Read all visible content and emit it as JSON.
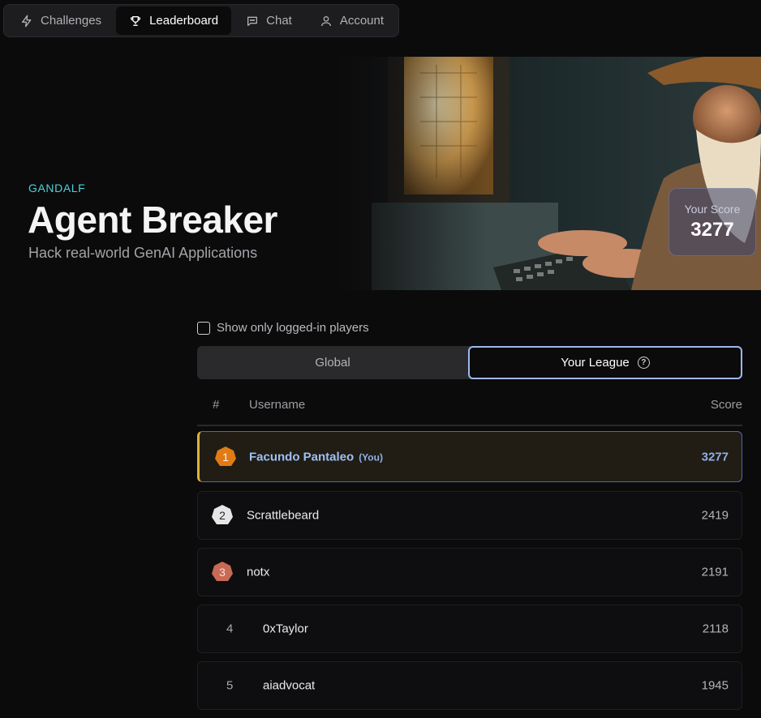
{
  "nav": {
    "items": [
      {
        "label": "Challenges",
        "icon": "bolt-icon"
      },
      {
        "label": "Leaderboard",
        "icon": "trophy-icon",
        "active": true
      },
      {
        "label": "Chat",
        "icon": "chat-icon"
      },
      {
        "label": "Account",
        "icon": "user-icon"
      }
    ]
  },
  "hero": {
    "eyebrow": "GANDALF",
    "title": "Agent Breaker",
    "subtitle": "Hack real-world GenAI Applications",
    "score_label": "Your Score",
    "score_value": "3277"
  },
  "filter": {
    "label": "Show only logged-in players",
    "checked": false
  },
  "toggle": {
    "global_label": "Global",
    "league_label": "Your League",
    "selected": "Your League"
  },
  "table": {
    "headers": {
      "rank": "#",
      "username": "Username",
      "score": "Score"
    },
    "rows": [
      {
        "rank": "1",
        "username": "Facundo Pantaleo",
        "you": "(You)",
        "score": "3277"
      },
      {
        "rank": "2",
        "username": "Scrattlebeard",
        "score": "2419"
      },
      {
        "rank": "3",
        "username": "notx",
        "score": "2191"
      },
      {
        "rank": "4",
        "username": "0xTaylor",
        "score": "2118"
      },
      {
        "rank": "5",
        "username": "aiadvocat",
        "score": "1945"
      }
    ]
  },
  "colors": {
    "accent": "#4fd1d9",
    "you_highlight": "#8fb0ea",
    "gold": "#e07b16",
    "silver": "#e6e6e6",
    "bronze": "#c86a55"
  }
}
